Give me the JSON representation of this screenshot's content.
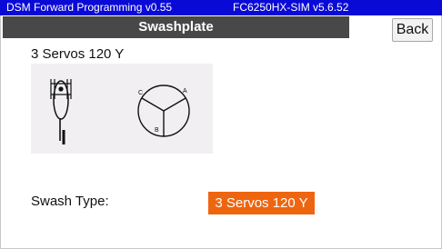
{
  "status_bar": {
    "app_version": "DSM Forward Programming v0.55",
    "receiver_version": "FC6250HX-SIM v5.6.52",
    "background_color": "#0a0ad7"
  },
  "header": {
    "title": "Swashplate",
    "back_label": "Back"
  },
  "swash_diagram": {
    "heading": "3 Servos 120 Y",
    "servo_labels": {
      "left": "C",
      "right": "A",
      "bottom": "B"
    },
    "heli_icon": "helicopter-side-icon"
  },
  "settings": {
    "swash_type_label": "Swash Type:",
    "swash_type_value": "3 Servos 120 Y",
    "accent_color": "#ee6510"
  }
}
